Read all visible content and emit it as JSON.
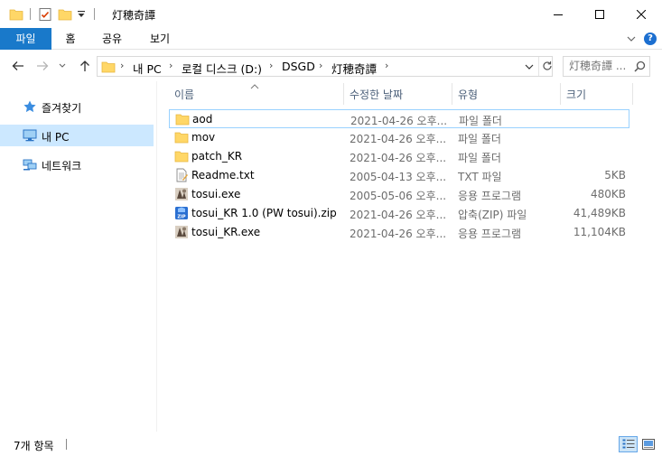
{
  "window": {
    "title": "灯穂奇譚",
    "minimize_glyph": "—",
    "maximize_glyph": "☐",
    "close_glyph": "✕"
  },
  "ribbon": {
    "tabs": [
      "파일",
      "홈",
      "공유",
      "보기"
    ],
    "help_glyph": "?"
  },
  "address": {
    "crumbs": [
      "내 PC",
      "로컬 디스크 (D:)",
      "DSGD",
      "灯穂奇譚"
    ],
    "separator": "›"
  },
  "search": {
    "placeholder": "灯穂奇譚 ..."
  },
  "nav_pane": {
    "items": [
      {
        "label": "즐겨찾기",
        "icon": "star-icon",
        "selected": false
      },
      {
        "label": "내 PC",
        "icon": "computer-icon",
        "selected": true
      },
      {
        "label": "네트워크",
        "icon": "network-icon",
        "selected": false
      }
    ]
  },
  "columns": {
    "name": "이름",
    "date": "수정한 날짜",
    "type": "유형",
    "size": "크기"
  },
  "files": [
    {
      "name": "aod",
      "date": "2021-04-26 오후...",
      "type": "파일 폴더",
      "size": "",
      "icon": "folder-icon"
    },
    {
      "name": "mov",
      "date": "2021-04-26 오후...",
      "type": "파일 폴더",
      "size": "",
      "icon": "folder-icon"
    },
    {
      "name": "patch_KR",
      "date": "2021-04-26 오후...",
      "type": "파일 폴더",
      "size": "",
      "icon": "folder-icon"
    },
    {
      "name": "Readme.txt",
      "date": "2005-04-13 오후...",
      "type": "TXT 파일",
      "size": "5KB",
      "icon": "text-file-icon"
    },
    {
      "name": "tosui.exe",
      "date": "2005-05-06 오후...",
      "type": "응용 프로그램",
      "size": "480KB",
      "icon": "app-icon"
    },
    {
      "name": "tosui_KR 1.0 (PW tosui).zip",
      "date": "2021-04-26 오후...",
      "type": "압축(ZIP) 파일",
      "size": "41,489KB",
      "icon": "zip-icon"
    },
    {
      "name": "tosui_KR.exe",
      "date": "2021-04-26 오후...",
      "type": "응용 프로그램",
      "size": "11,104KB",
      "icon": "app-icon"
    }
  ],
  "status": {
    "count": "7개 항목"
  },
  "colors": {
    "file_tab": "#1979ca",
    "selected_nav": "#cce8ff",
    "folder": "#ffd767",
    "folder_dark": "#e8b63f",
    "header_text": "#4c607a"
  }
}
